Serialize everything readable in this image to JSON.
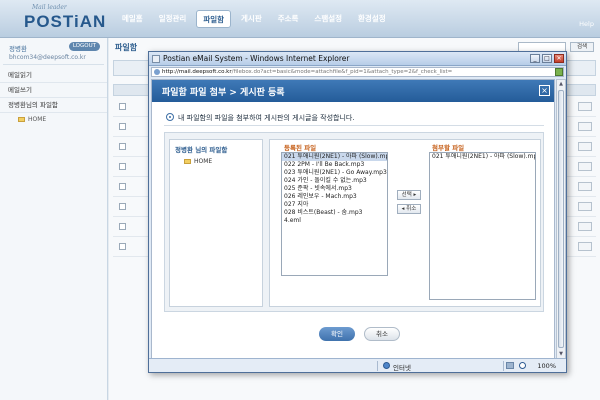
{
  "app": {
    "logo_tagline": "Mail leader",
    "logo_text": "POSTiAN",
    "nav": [
      "메일홈",
      "일정관리",
      "파일함",
      "게시판",
      "주소록",
      "스팸설정",
      "환경설정"
    ],
    "nav_active_index": 2,
    "help_label": "Help",
    "colors": {
      "accent": "#2c5d8f",
      "header": "#245c99",
      "orange": "#c6601a"
    }
  },
  "sidebar": {
    "user_name": "정병환",
    "logout_label": "LOGOUT",
    "email": "bhcom34@deepsoft.co.kr",
    "items": [
      "메일읽기",
      "메일쓰기",
      "정병환님의 파일함"
    ],
    "home_label": "HOME"
  },
  "main": {
    "title": "파일함",
    "search_button": "검색"
  },
  "ie": {
    "window_title": "Postian eMail System - Windows Internet Explorer",
    "address_domain": "http://mail.deepsoft.co.kr",
    "address_rest": "/filebox.do?act=basic&mode=attachfile&f_pid=1&attach_type=2&f_check_list=",
    "status_zone": "인터넷",
    "zoom": "100%"
  },
  "dialog": {
    "title": "파일함 파일 첨부 > 게시판 등록",
    "description": "내 파일함의 파일을 첨부하여 게시판의 게시글을 작성합니다.",
    "tree_label": "정병환 님의 파일함",
    "tree_home": "HOME",
    "registered_label": "등록된 파일",
    "registered_files": [
      "021 투애니원(2NE1) - 아파 (Slow).mp3",
      "022 2PM - I'll Be Back.mp3",
      "023 투애니원(2NE1) - Go Away.mp3",
      "024 가인 - 돌이킬 수 없는.mp3",
      "025 준팍 - 빗속에서.mp3",
      "026 레인보우 - Mach.mp3",
      "027 지아",
      "028 비스트(Beast) - 숨.mp3",
      "4.eml"
    ],
    "selected_index": 0,
    "select_button": "선택 ▸",
    "remove_button": "◂ 취소",
    "attach_label": "첨부할 파일",
    "attach_files": [
      "021 투애니원(2NE1) - 아파 (Slow).mp3"
    ],
    "ok_button": "확인",
    "cancel_button": "취소"
  }
}
